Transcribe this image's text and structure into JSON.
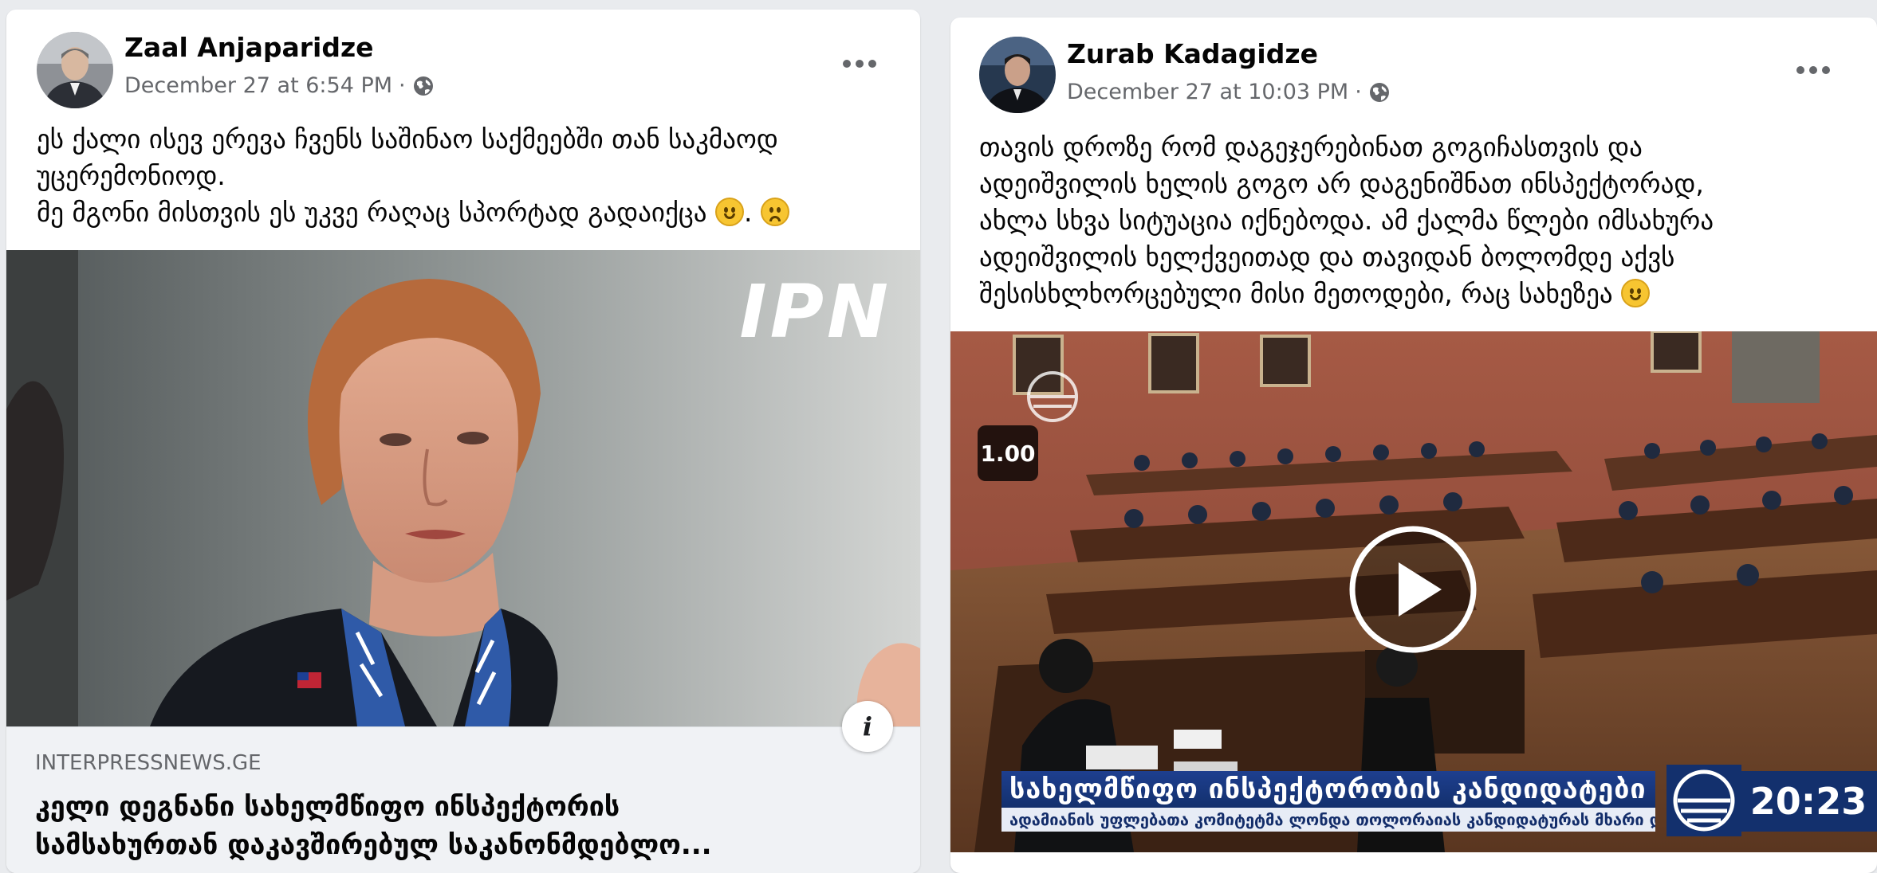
{
  "post1": {
    "author": "Zaal Anjaparidze",
    "timestamp": "December 27 at 6:54 PM",
    "separator": "·",
    "text_lines": [
      "ეს ქალი ისევ ერევა ჩვენს საშინაო საქმეებში თან საკმაოდ",
      "უცერემონიოდ.",
      "მე მგონი მისთვის ეს უკვე რაღაც სპორტად გადაიქცა "
    ],
    "emoji_separator": ". ",
    "image": {
      "watermark": "IPN",
      "info_label": "i"
    },
    "link": {
      "domain": "INTERPRESSNEWS.GE",
      "title_lines": [
        "კელი დეგნანი სახელმწიფო ინსპექტორის",
        "სამსახურთან დაკავშირებულ საკანონმდებლო..."
      ]
    }
  },
  "post2": {
    "author": "Zurab Kadagidze",
    "timestamp": "December 27 at 10:03 PM",
    "separator": "·",
    "text_lines": [
      "თავის დროზე რომ დაგეჯერებინათ გოგიჩასთვის და",
      "ადეიშვილის ხელის გოგო არ დაგენიშნათ ინსპექტორად,",
      "ახლა სხვა სიტუაცია იქნებოდა. ამ ქალმა წლები იმსახურა",
      "ადეიშვილის ხელქვეითად და თავიდან ბოლომდე აქვს",
      "შესისხლხორცებული მისი მეთოდები, რაც სახეზეა "
    ],
    "video": {
      "speed_badge": "1.00",
      "lower_third_title": "სახელმწიფო ინსპექტორობის კანდიდატები",
      "lower_third_subtitle": "ადამიანის უფლებათა კომიტეტმა ლონდა თოლორაიას კანდიდატურას მხარი დაუჭირა",
      "clock": "20:23"
    }
  },
  "colors": {
    "card_bg": "#ffffff",
    "page_bg": "#e9ebee",
    "secondary_text": "#65676b",
    "tv_blue": "#13306d"
  },
  "icons": [
    "globe-icon",
    "more-options-icon",
    "smile-emoji-icon",
    "sad-emoji-icon",
    "info-icon",
    "play-icon",
    "channel-logo-icon"
  ]
}
